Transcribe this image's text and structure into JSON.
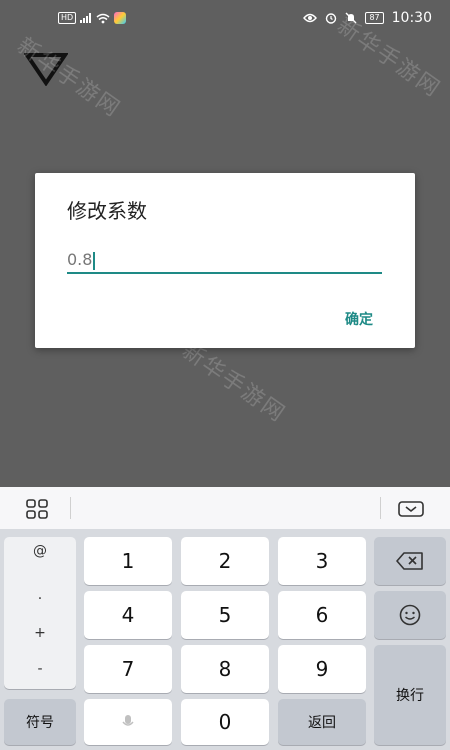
{
  "status_bar": {
    "left_badge": "HD",
    "time": "10:30",
    "battery": "87"
  },
  "watermark": "新华手游网",
  "dialog": {
    "title": "修改系数",
    "input_value": "0.8",
    "confirm_label": "确定"
  },
  "keyboard": {
    "symbols": [
      "@",
      ".",
      "+",
      "-"
    ],
    "keys": {
      "k1": "1",
      "k2": "2",
      "k3": "3",
      "k4": "4",
      "k5": "5",
      "k6": "6",
      "k7": "7",
      "k8": "8",
      "k9": "9",
      "k0": "0"
    },
    "symbols_key": "符号",
    "return_key": "返回",
    "newline_key": "换行"
  },
  "colors": {
    "accent": "#1e8a86",
    "overlay": "#5f5f5f",
    "keyboard_bg": "#d7dadf"
  }
}
